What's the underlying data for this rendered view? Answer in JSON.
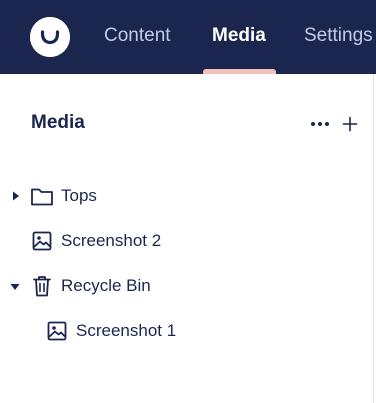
{
  "header": {
    "tabs": [
      {
        "label": "Content",
        "active": false
      },
      {
        "label": "Media",
        "active": true
      },
      {
        "label": "Settings",
        "active": false
      }
    ],
    "logo_icon": "umbraco-logo-icon",
    "background_color": "#1b264f",
    "active_indicator_color": "#f5c1bc"
  },
  "sidebar": {
    "title": "Media",
    "actions": {
      "more_icon": "more-options-icon",
      "add_icon": "plus-icon"
    },
    "tree": [
      {
        "label": "Tops",
        "icon": "folder-icon",
        "expanded": false,
        "has_children": true,
        "depth": 0
      },
      {
        "label": "Screenshot 2",
        "icon": "image-icon",
        "has_children": false,
        "depth": 0
      },
      {
        "label": "Recycle Bin",
        "icon": "trash-icon",
        "expanded": true,
        "has_children": true,
        "depth": 0
      },
      {
        "label": "Screenshot 1",
        "icon": "image-icon",
        "has_children": false,
        "depth": 1
      }
    ]
  }
}
